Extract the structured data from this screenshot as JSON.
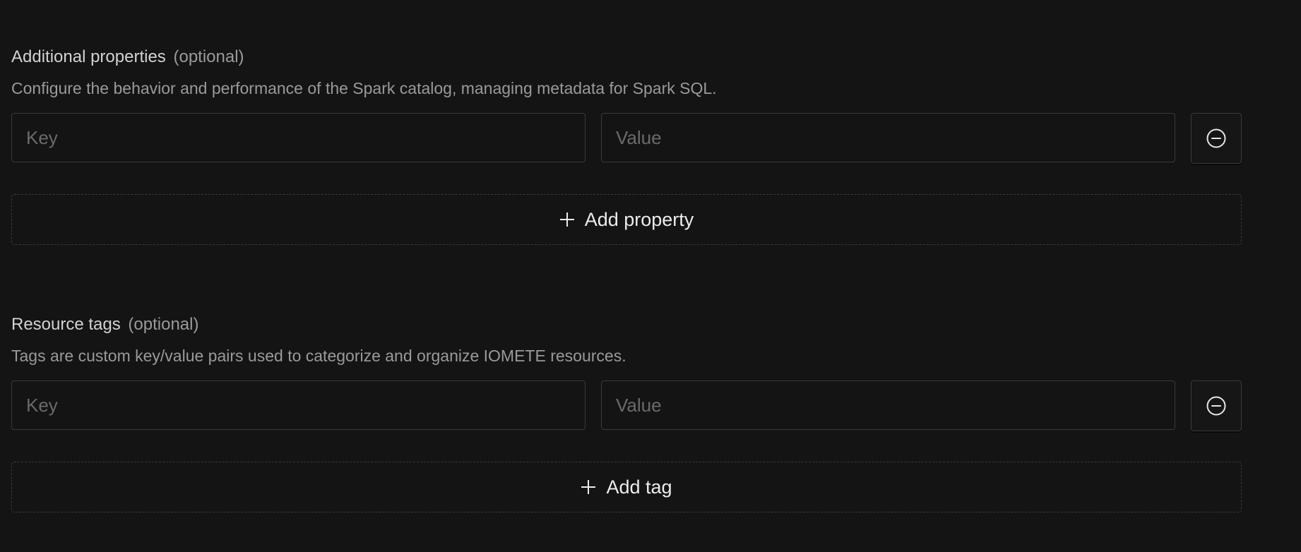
{
  "additional_properties": {
    "title": "Additional properties",
    "optional": "(optional)",
    "description": "Configure the behavior and performance of the Spark catalog, managing metadata for Spark SQL.",
    "key_placeholder": "Key",
    "value_placeholder": "Value",
    "remove_icon": "minus-circle-icon",
    "add_icon": "plus-icon",
    "add_label": "Add property"
  },
  "resource_tags": {
    "title": "Resource tags",
    "optional": "(optional)",
    "description": "Tags are custom key/value pairs used to categorize and organize IOMETE resources.",
    "key_placeholder": "Key",
    "value_placeholder": "Value",
    "remove_icon": "minus-circle-icon",
    "add_icon": "plus-icon",
    "add_label": "Add tag"
  }
}
